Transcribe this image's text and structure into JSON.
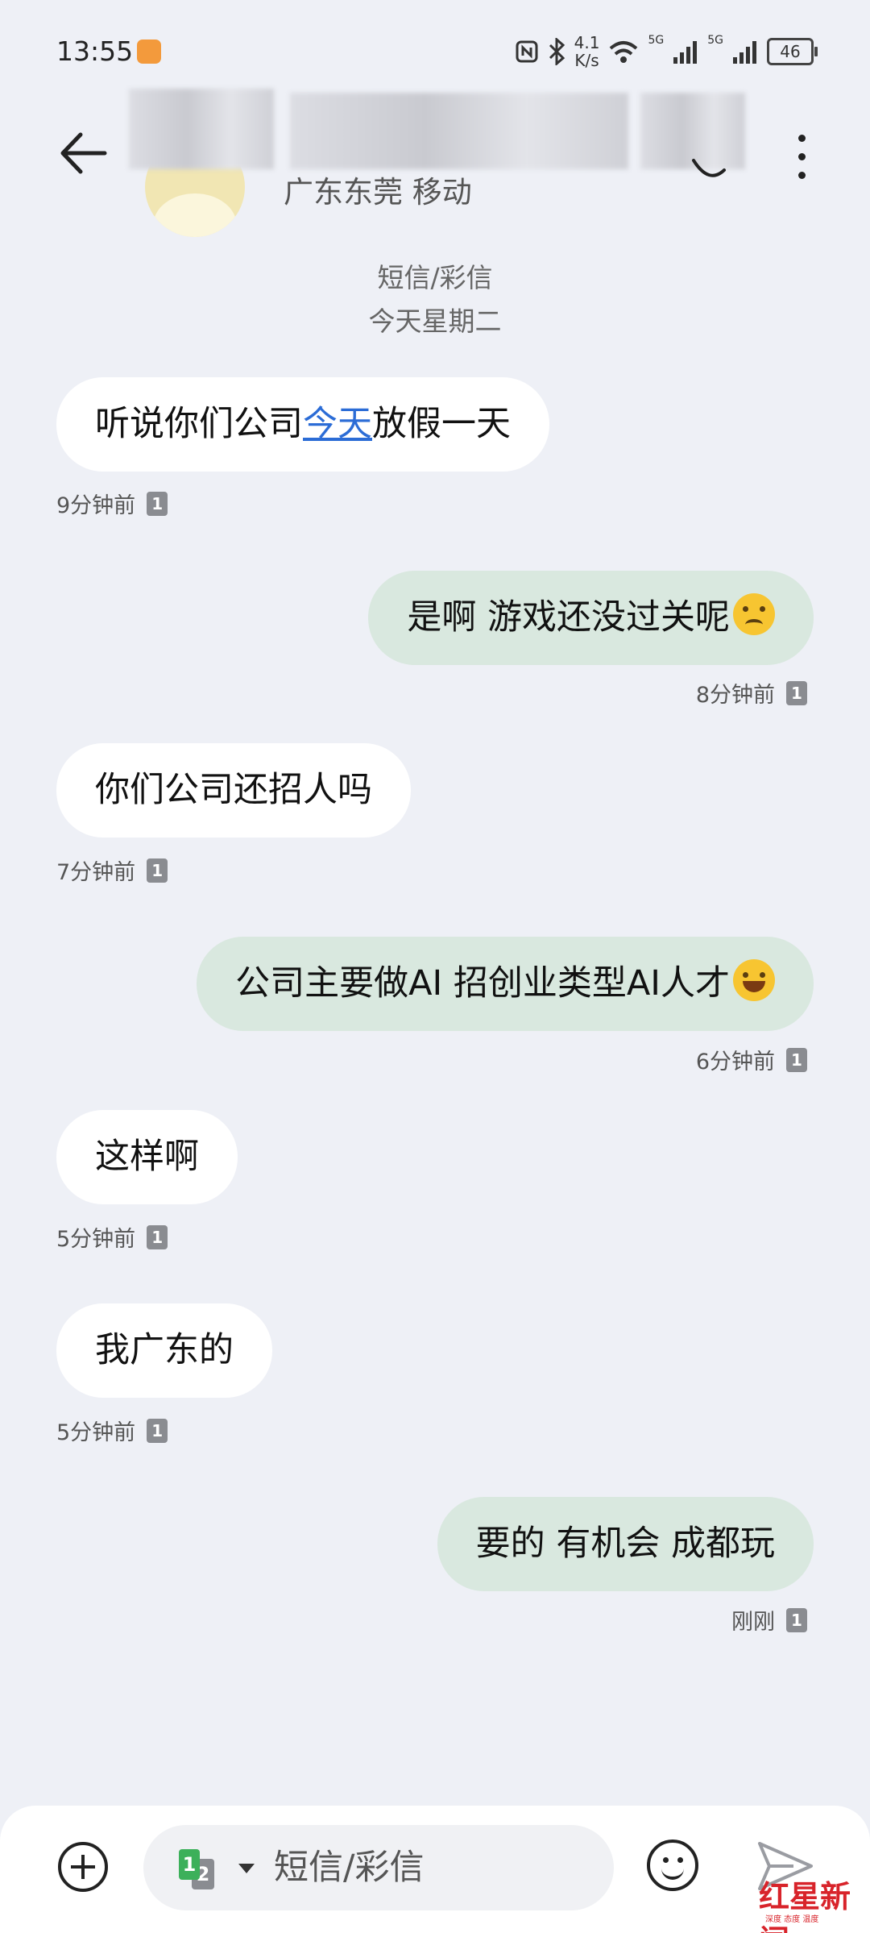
{
  "status_bar": {
    "time": "13:55",
    "net_speed_value": "4.1",
    "net_speed_unit": "K/s",
    "sim1_label": "5G",
    "sim2_label": "5G",
    "battery": "46"
  },
  "header": {
    "contact_subtitle": "广东东莞 移动"
  },
  "conversation": {
    "type_label": "短信/彩信",
    "date_label": "今天星期二"
  },
  "messages": [
    {
      "direction": "incoming",
      "text_before": "听说你们公司",
      "link_text": "今天",
      "text_after": "放假一天",
      "time": "9分钟前",
      "sim": "1"
    },
    {
      "direction": "outgoing",
      "text": "是啊  游戏还没过关呢",
      "emoji": "sad-tear-emoji",
      "time": "8分钟前",
      "sim": "1"
    },
    {
      "direction": "incoming",
      "text": "你们公司还招人吗",
      "time": "7分钟前",
      "sim": "1"
    },
    {
      "direction": "outgoing",
      "text": "公司主要做AI  招创业类型AI人才",
      "emoji": "tears-of-joy-emoji",
      "time": "6分钟前",
      "sim": "1"
    },
    {
      "direction": "incoming",
      "text": "这样啊",
      "time": "5分钟前",
      "sim": "1"
    },
    {
      "direction": "incoming",
      "text": "我广东的",
      "time": "5分钟前",
      "sim": "1"
    },
    {
      "direction": "outgoing",
      "text": "要的 有机会 成都玩",
      "time": "刚刚",
      "sim": "1"
    }
  ],
  "composer": {
    "sim_primary": "1",
    "sim_secondary": "2",
    "placeholder": "短信/彩信",
    "value": ""
  },
  "watermark": {
    "brand": "红星新闻",
    "tagline": "深度 态度 温度"
  },
  "colors": {
    "background": "#eef0f6",
    "incoming_bubble": "#ffffff",
    "outgoing_bubble": "#d9e8df",
    "link": "#2b6cd6",
    "sim_active": "#3cb05a",
    "watermark": "#d8232a"
  }
}
